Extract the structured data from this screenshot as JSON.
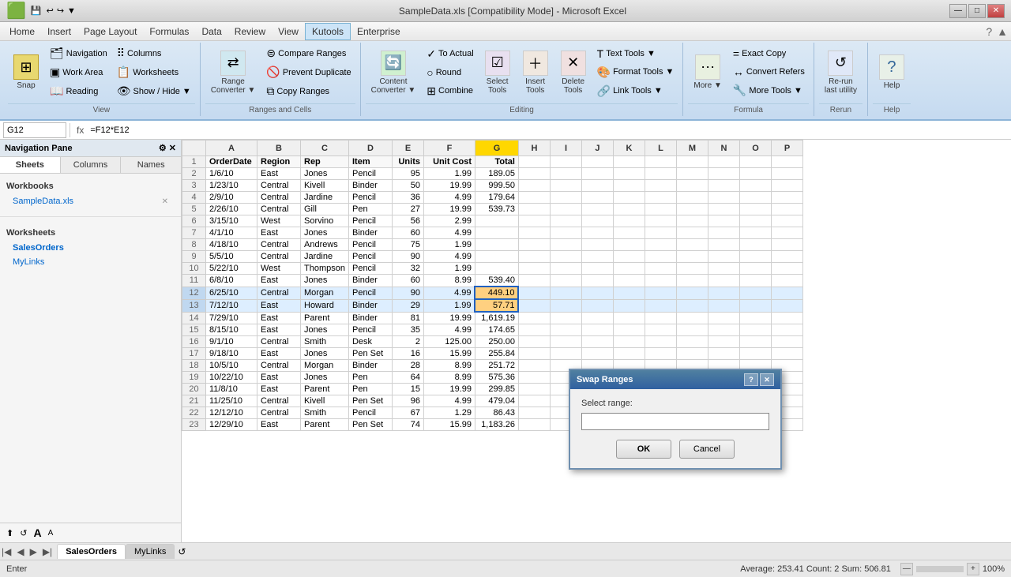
{
  "titlebar": {
    "title": "SampleData.xls [Compatibility Mode] - Microsoft Excel",
    "controls": [
      "_",
      "□",
      "×"
    ]
  },
  "menubar": {
    "items": [
      "Home",
      "Insert",
      "Page Layout",
      "Formulas",
      "Data",
      "Review",
      "View",
      "Kutools",
      "Enterprise"
    ]
  },
  "ribbon": {
    "active_tab": "Kutools",
    "groups": [
      {
        "label": "View",
        "buttons": [
          {
            "label": "Snap",
            "icon": "⊞",
            "type": "large"
          },
          {
            "label": "Navigation",
            "icon": "🗂",
            "type": "small"
          },
          {
            "label": "Work Area",
            "icon": "▣",
            "type": "small"
          },
          {
            "label": "Reading",
            "icon": "📖",
            "type": "small"
          },
          {
            "label": "Columns",
            "icon": "⠿",
            "type": "small"
          },
          {
            "label": "Worksheets",
            "icon": "📋",
            "type": "small"
          },
          {
            "label": "Show / Hide ▼",
            "icon": "👁",
            "type": "small"
          }
        ]
      },
      {
        "label": "Ranges and Cells",
        "buttons": [
          {
            "label": "Range\nConverter ▼",
            "icon": "⇄",
            "type": "large"
          },
          {
            "label": "Compare Ranges",
            "icon": "⊜",
            "type": "small"
          },
          {
            "label": "Prevent Duplicate",
            "icon": "🚫",
            "type": "small"
          },
          {
            "label": "Copy Ranges",
            "icon": "⧉",
            "type": "small"
          }
        ]
      },
      {
        "label": "Editing",
        "buttons": [
          {
            "label": "Content\nConverter ▼",
            "icon": "🔄",
            "type": "large"
          },
          {
            "label": "To Actual",
            "icon": "✓",
            "type": "small"
          },
          {
            "label": "Round",
            "icon": "○",
            "type": "small"
          },
          {
            "label": "Combine",
            "icon": "⊞",
            "type": "small"
          },
          {
            "label": "Select\nTools",
            "icon": "☑",
            "type": "large"
          },
          {
            "label": "Insert\nTools",
            "icon": "＋",
            "type": "large"
          },
          {
            "label": "Delete\nTools",
            "icon": "✕",
            "type": "large"
          },
          {
            "label": "Text Tools ▼",
            "icon": "T",
            "type": "small"
          },
          {
            "label": "Format Tools ▼",
            "icon": "🎨",
            "type": "small"
          },
          {
            "label": "Link Tools ▼",
            "icon": "🔗",
            "type": "small"
          }
        ]
      },
      {
        "label": "Formula",
        "buttons": [
          {
            "label": "More ▼",
            "icon": "⋯",
            "type": "large"
          },
          {
            "label": "Exact Copy",
            "icon": "=",
            "type": "small"
          },
          {
            "label": "Convert Refers",
            "icon": "↔",
            "type": "small"
          },
          {
            "label": "More Tools ▼",
            "icon": "🔧",
            "type": "small"
          }
        ]
      },
      {
        "label": "Rerun",
        "buttons": [
          {
            "label": "Re-run\nlast utility",
            "icon": "↺",
            "type": "large"
          }
        ]
      },
      {
        "label": "Help",
        "buttons": [
          {
            "label": "Help",
            "icon": "?",
            "type": "large"
          }
        ]
      }
    ]
  },
  "formulabar": {
    "cell_ref": "G12",
    "formula": "=F12*E12"
  },
  "nav_pane": {
    "title": "Navigation Pane",
    "tabs": [
      "Sheets",
      "Columns",
      "Names"
    ],
    "active_tab": "Sheets",
    "workbooks_label": "Workbooks",
    "workbook_name": "SampleData.xls",
    "worksheets_label": "Worksheets",
    "sheets": [
      "SalesOrders",
      "MyLinks"
    ]
  },
  "spreadsheet": {
    "columns": [
      "",
      "A",
      "B",
      "C",
      "D",
      "E",
      "F",
      "G",
      "H",
      "I",
      "J",
      "K",
      "L",
      "M",
      "N",
      "O",
      "P"
    ],
    "col_headers": [
      "OrderDate",
      "Region",
      "Rep",
      "Item",
      "Units",
      "Unit Cost",
      "Total"
    ],
    "rows": [
      {
        "row": 1,
        "data": [
          "OrderDate",
          "Region",
          "Rep",
          "Item",
          "Units",
          "Unit Cost",
          "Total"
        ]
      },
      {
        "row": 2,
        "data": [
          "1/6/10",
          "East",
          "Jones",
          "Pencil",
          "95",
          "1.99",
          "189.05"
        ]
      },
      {
        "row": 3,
        "data": [
          "1/23/10",
          "Central",
          "Kivell",
          "Binder",
          "50",
          "19.99",
          "999.50"
        ]
      },
      {
        "row": 4,
        "data": [
          "2/9/10",
          "Central",
          "Jardine",
          "Pencil",
          "36",
          "4.99",
          "179.64"
        ]
      },
      {
        "row": 5,
        "data": [
          "2/26/10",
          "Central",
          "Gill",
          "Pen",
          "27",
          "19.99",
          "539.73"
        ]
      },
      {
        "row": 6,
        "data": [
          "3/15/10",
          "West",
          "Sorvino",
          "Pencil",
          "56",
          "2.99",
          ""
        ]
      },
      {
        "row": 7,
        "data": [
          "4/1/10",
          "East",
          "Jones",
          "Binder",
          "60",
          "4.99",
          ""
        ]
      },
      {
        "row": 8,
        "data": [
          "4/18/10",
          "Central",
          "Andrews",
          "Pencil",
          "75",
          "1.99",
          ""
        ]
      },
      {
        "row": 9,
        "data": [
          "5/5/10",
          "Central",
          "Jardine",
          "Pencil",
          "90",
          "4.99",
          ""
        ]
      },
      {
        "row": 10,
        "data": [
          "5/22/10",
          "West",
          "Thompson",
          "Pencil",
          "32",
          "1.99",
          ""
        ]
      },
      {
        "row": 11,
        "data": [
          "6/8/10",
          "East",
          "Jones",
          "Binder",
          "60",
          "8.99",
          "539.40"
        ]
      },
      {
        "row": 12,
        "data": [
          "6/25/10",
          "Central",
          "Morgan",
          "Pencil",
          "90",
          "4.99",
          "449.10"
        ]
      },
      {
        "row": 13,
        "data": [
          "7/12/10",
          "East",
          "Howard",
          "Binder",
          "29",
          "1.99",
          "57.71"
        ]
      },
      {
        "row": 14,
        "data": [
          "7/29/10",
          "East",
          "Parent",
          "Binder",
          "81",
          "19.99",
          "1,619.19"
        ]
      },
      {
        "row": 15,
        "data": [
          "8/15/10",
          "East",
          "Jones",
          "Pencil",
          "35",
          "4.99",
          "174.65"
        ]
      },
      {
        "row": 16,
        "data": [
          "9/1/10",
          "Central",
          "Smith",
          "Desk",
          "2",
          "125.00",
          "250.00"
        ]
      },
      {
        "row": 17,
        "data": [
          "9/18/10",
          "East",
          "Jones",
          "Pen Set",
          "16",
          "15.99",
          "255.84"
        ]
      },
      {
        "row": 18,
        "data": [
          "10/5/10",
          "Central",
          "Morgan",
          "Binder",
          "28",
          "8.99",
          "251.72"
        ]
      },
      {
        "row": 19,
        "data": [
          "10/22/10",
          "East",
          "Jones",
          "Pen",
          "64",
          "8.99",
          "575.36"
        ]
      },
      {
        "row": 20,
        "data": [
          "11/8/10",
          "East",
          "Parent",
          "Pen",
          "15",
          "19.99",
          "299.85"
        ]
      },
      {
        "row": 21,
        "data": [
          "11/25/10",
          "Central",
          "Kivell",
          "Pen Set",
          "96",
          "4.99",
          "479.04"
        ]
      },
      {
        "row": 22,
        "data": [
          "12/12/10",
          "Central",
          "Smith",
          "Pencil",
          "67",
          "1.29",
          "86.43"
        ]
      },
      {
        "row": 23,
        "data": [
          "12/29/10",
          "East",
          "Parent",
          "Pen Set",
          "74",
          "15.99",
          "1,183.26"
        ]
      }
    ]
  },
  "dialog": {
    "title": "Swap Ranges",
    "select_range_label": "Select range:",
    "input_value": "",
    "ok_label": "OK",
    "cancel_label": "Cancel"
  },
  "sheet_tabs": {
    "sheets": [
      "SalesOrders",
      "MyLinks"
    ],
    "active": "SalesOrders"
  },
  "statusbar": {
    "mode": "Enter",
    "stats": "Average: 253.41    Count: 2    Sum: 506.81",
    "zoom": "100%"
  }
}
